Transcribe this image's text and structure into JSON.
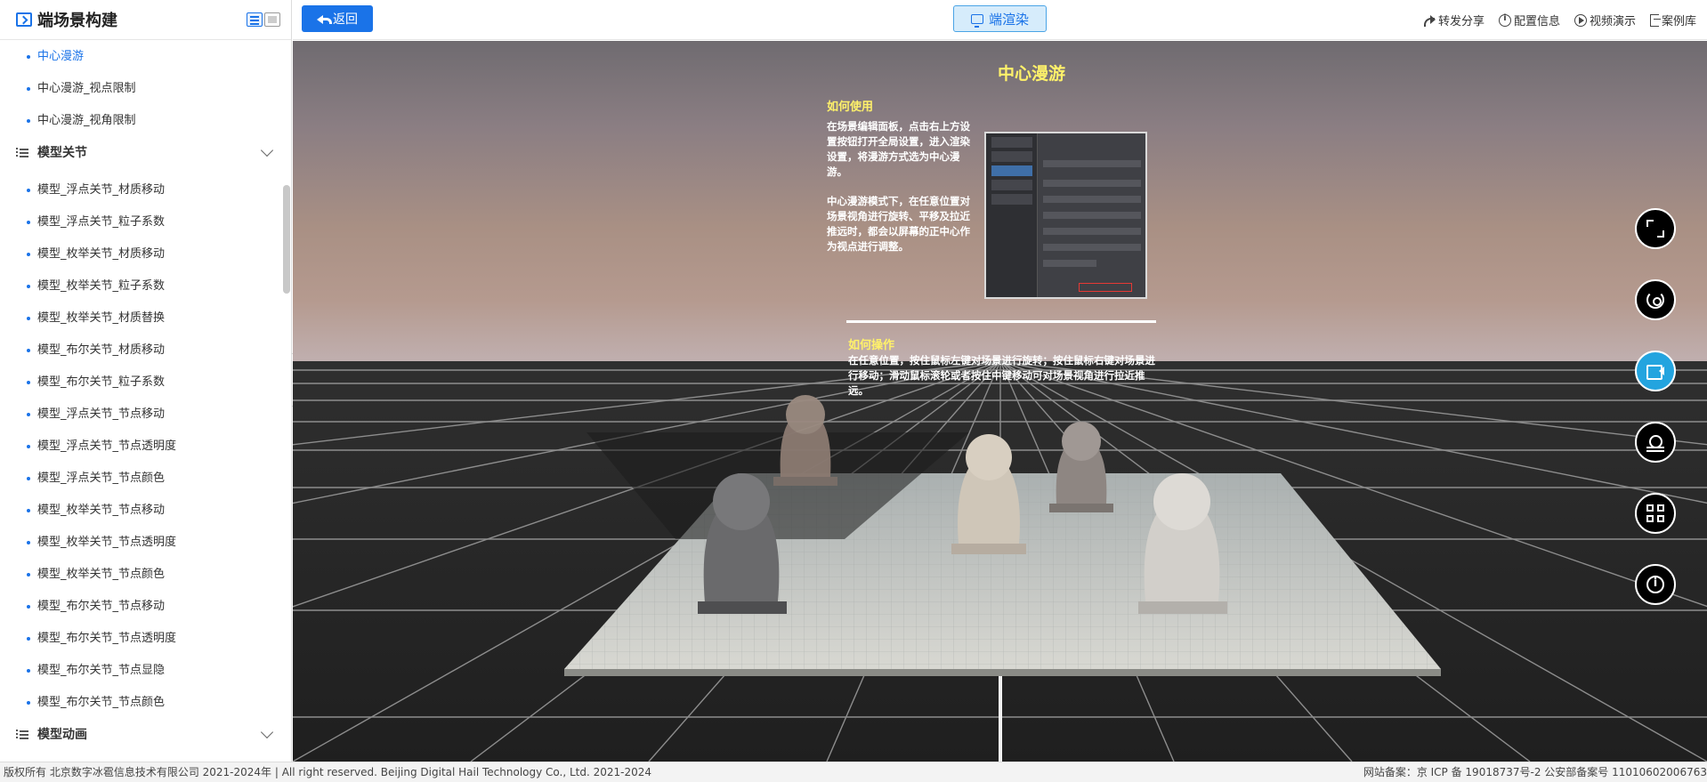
{
  "sidebar": {
    "title": "端场景构建",
    "items_top": [
      {
        "label": "中心漫游",
        "active": true
      },
      {
        "label": "中心漫游_视点限制"
      },
      {
        "label": "中心漫游_视角限制"
      }
    ],
    "group_joints": {
      "label": "模型关节"
    },
    "joint_items": [
      "模型_浮点关节_材质移动",
      "模型_浮点关节_粒子系数",
      "模型_枚举关节_材质移动",
      "模型_枚举关节_粒子系数",
      "模型_枚举关节_材质替换",
      "模型_布尔关节_材质移动",
      "模型_布尔关节_粒子系数",
      "模型_浮点关节_节点移动",
      "模型_浮点关节_节点透明度",
      "模型_浮点关节_节点颜色",
      "模型_枚举关节_节点移动",
      "模型_枚举关节_节点透明度",
      "模型_枚举关节_节点颜色",
      "模型_布尔关节_节点移动",
      "模型_布尔关节_节点透明度",
      "模型_布尔关节_节点显隐",
      "模型_布尔关节_节点颜色"
    ],
    "group_animation": {
      "label": "模型动画"
    }
  },
  "topbar": {
    "back_label": "返回",
    "render_label": "端渲染",
    "actions": {
      "share": "转发分享",
      "config": "配置信息",
      "video": "视频演示",
      "cases": "案例库"
    }
  },
  "scene": {
    "title": "中心漫游",
    "usage_heading": "如何使用",
    "usage_p1": "在场景编辑面板，点击右上方设置按钮打开全局设置，进入渲染设置，将漫游方式选为中心漫游。",
    "usage_p2": "中心漫游模式下，在任意位置对场景视角进行旋转、平移及拉近推远时，都会以屏幕的正中心作为视点进行调整。",
    "operate_heading": "如何操作",
    "operate_text": "在任意位置，按住鼠标左键对场景进行旋转；按住鼠标右键对场景进行移动；滑动鼠标滚轮或者按住中键移动可对场景视角进行拉近推远。",
    "tools": [
      "fullscreen-icon",
      "rotate-icon",
      "camera-icon",
      "weather-icon",
      "grid-icon",
      "info-icon"
    ]
  },
  "colors": {
    "accent": "#1a73e8",
    "highlight_text": "#fff16a",
    "active_tool": "#23a4df"
  },
  "footer": {
    "copyright": "版权所有 北京数字冰雹信息技术有限公司 2021-2024年 | All right reserved. Beijing Digital Hail Technology Co., Ltd. 2021-2024",
    "icp": "网站备案：京 ICP 备 19018737号-2 公安部备案号 11010602006763"
  }
}
